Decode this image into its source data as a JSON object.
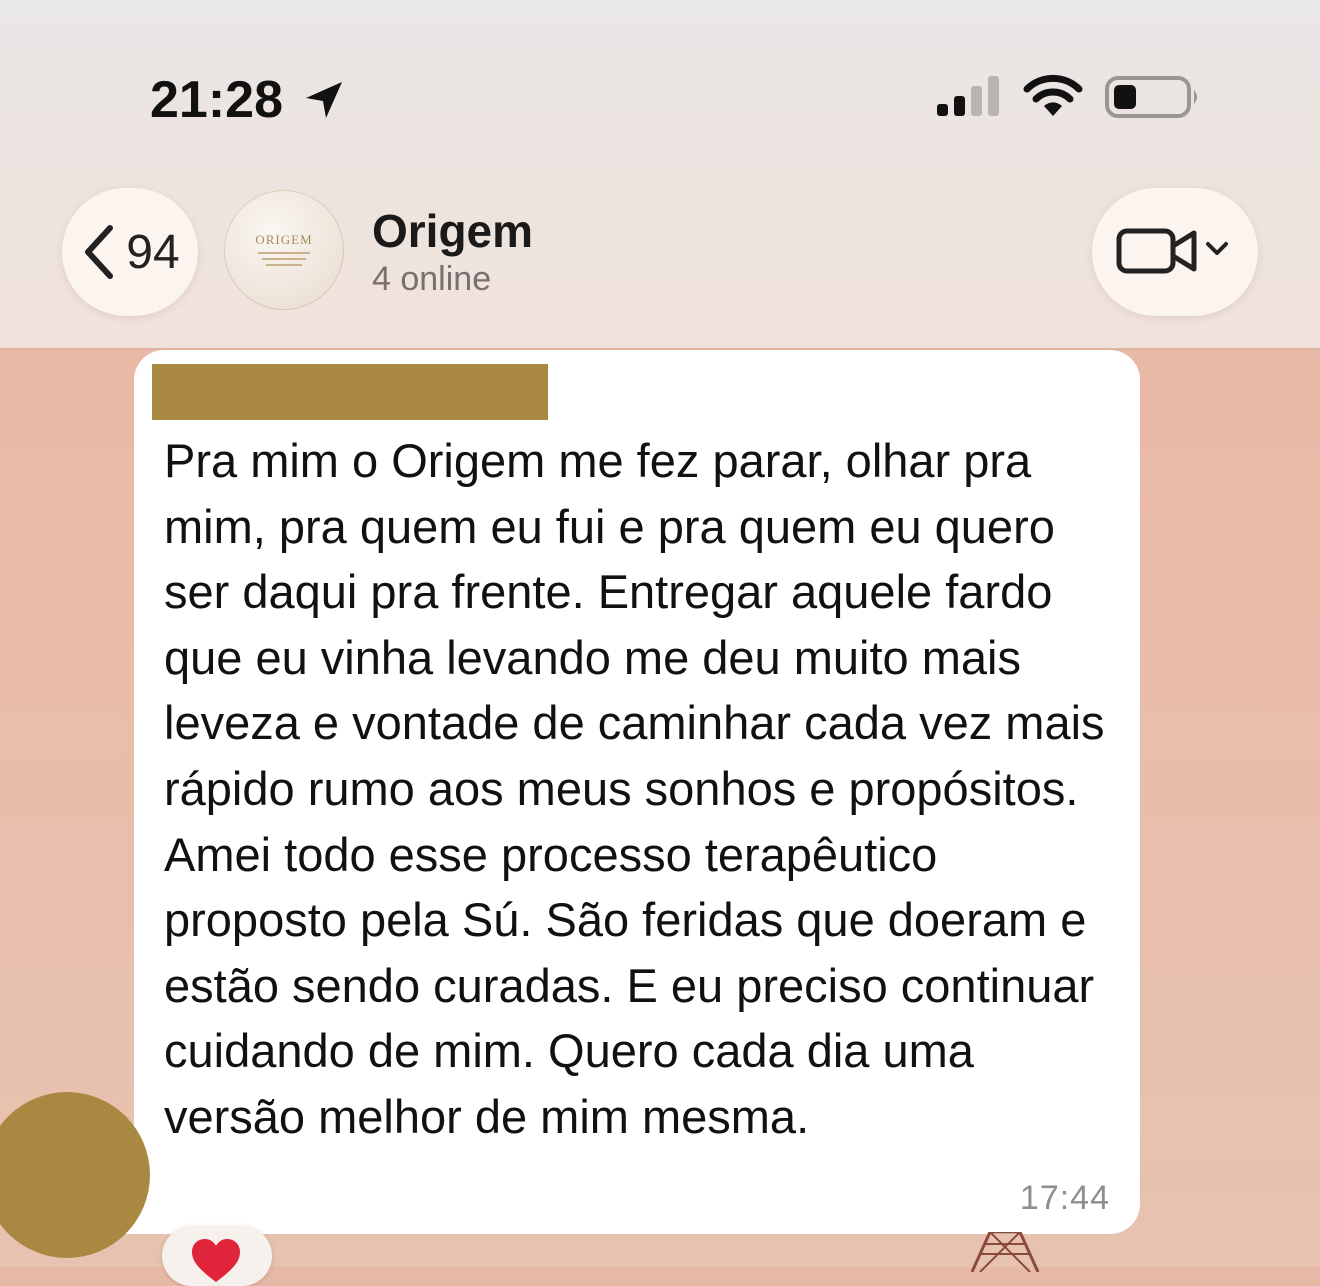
{
  "status_bar": {
    "time": "21:28",
    "icons": [
      "location-arrow-icon",
      "cellular-signal-icon",
      "wifi-icon",
      "battery-icon"
    ]
  },
  "nav": {
    "back_count": "94",
    "group_name": "Origem",
    "group_status": "4 online",
    "avatar_text": "ORIGEM",
    "icons": [
      "chevron-left-icon",
      "video-camera-icon",
      "chevron-down-icon"
    ]
  },
  "message": {
    "text": "Pra mim o Origem me fez parar, olhar pra mim, pra quem eu fui e pra quem eu quero ser daqui pra frente. Entregar aquele fardo que eu vinha levando me deu muito mais leveza e vontade de caminhar cada vez mais rápido rumo aos meus sonhos e propósitos. Amei todo esse processo terapêutico proposto pela Sú. São feridas que doeram e estão sendo curadas. E eu preciso continuar cuidando de mim. Quero cada dia uma versão melhor de mim mesma.",
    "time": "17:44",
    "reaction": "heart-icon"
  },
  "colors": {
    "redaction": "#a98842",
    "chat_background": "#e8bca8",
    "bubble": "#ffffff",
    "header": "#ece6e2"
  }
}
